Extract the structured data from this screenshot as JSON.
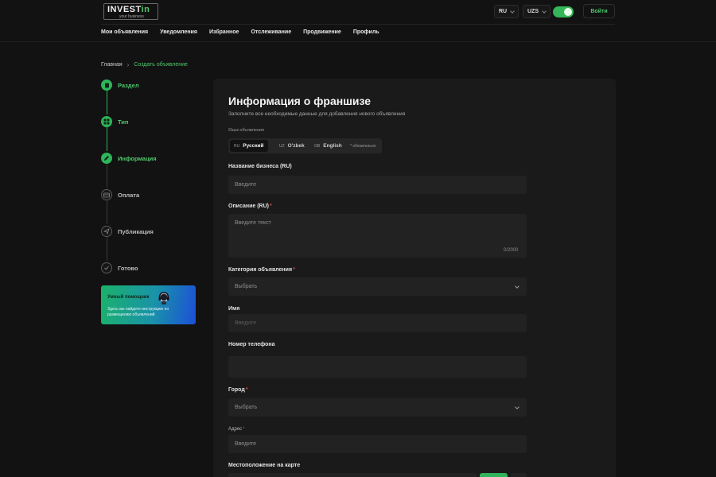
{
  "header": {
    "logo_main": "INVEST",
    "logo_accent": "in",
    "logo_tagline": "your business",
    "lang_select": "RU",
    "currency_select": "UZS",
    "login_label": "Войти"
  },
  "nav": {
    "items": [
      "Мои объявления",
      "Уведомления",
      "Избранное",
      "Отслеживание",
      "Продвижение",
      "Профиль"
    ]
  },
  "breadcrumb": {
    "home": "Главная",
    "current": "Создать объявление"
  },
  "steps": [
    {
      "label": "Раздел",
      "state": "done"
    },
    {
      "label": "Тип",
      "state": "done"
    },
    {
      "label": "Информация",
      "state": "active"
    },
    {
      "label": "Оплата",
      "state": "todo"
    },
    {
      "label": "Публикация",
      "state": "todo"
    },
    {
      "label": "Готово",
      "state": "todo"
    }
  ],
  "helper": {
    "title": "Умный помощник",
    "description": "Здесь вы найдете инструкцию по размещению объявлений"
  },
  "form": {
    "title": "Информация о франшизе",
    "subtitle": "Заполните все необходимые данные для добавления нового объявления",
    "language_label": "Язык объявления",
    "languages": [
      {
        "code": "RU",
        "label": "Русский"
      },
      {
        "code": "UZ",
        "label": "O'zbek"
      },
      {
        "code": "GB",
        "label": "English"
      }
    ],
    "required_note": "* обязательно",
    "business_name_label": "Название бизнеса (RU)",
    "business_name_placeholder": "Введите",
    "description_label": "Описание (RU)",
    "description_placeholder": "Введите текст",
    "description_counter": "0/2000",
    "category_label": "Категория объявления",
    "category_value": "Выбрать",
    "name_label": "Имя",
    "name_placeholder": "Введите",
    "phone_label": "Номер телефона",
    "city_label": "Город",
    "city_value": "Выбрать",
    "address_label": "Адрес",
    "address_placeholder": "Введите",
    "map_label": "Местоположение на карте"
  },
  "colors": {
    "accent": "#4ec86a",
    "background": "#121212",
    "card": "#1a1a1a",
    "field": "#222222",
    "required": "#d24b4b"
  }
}
